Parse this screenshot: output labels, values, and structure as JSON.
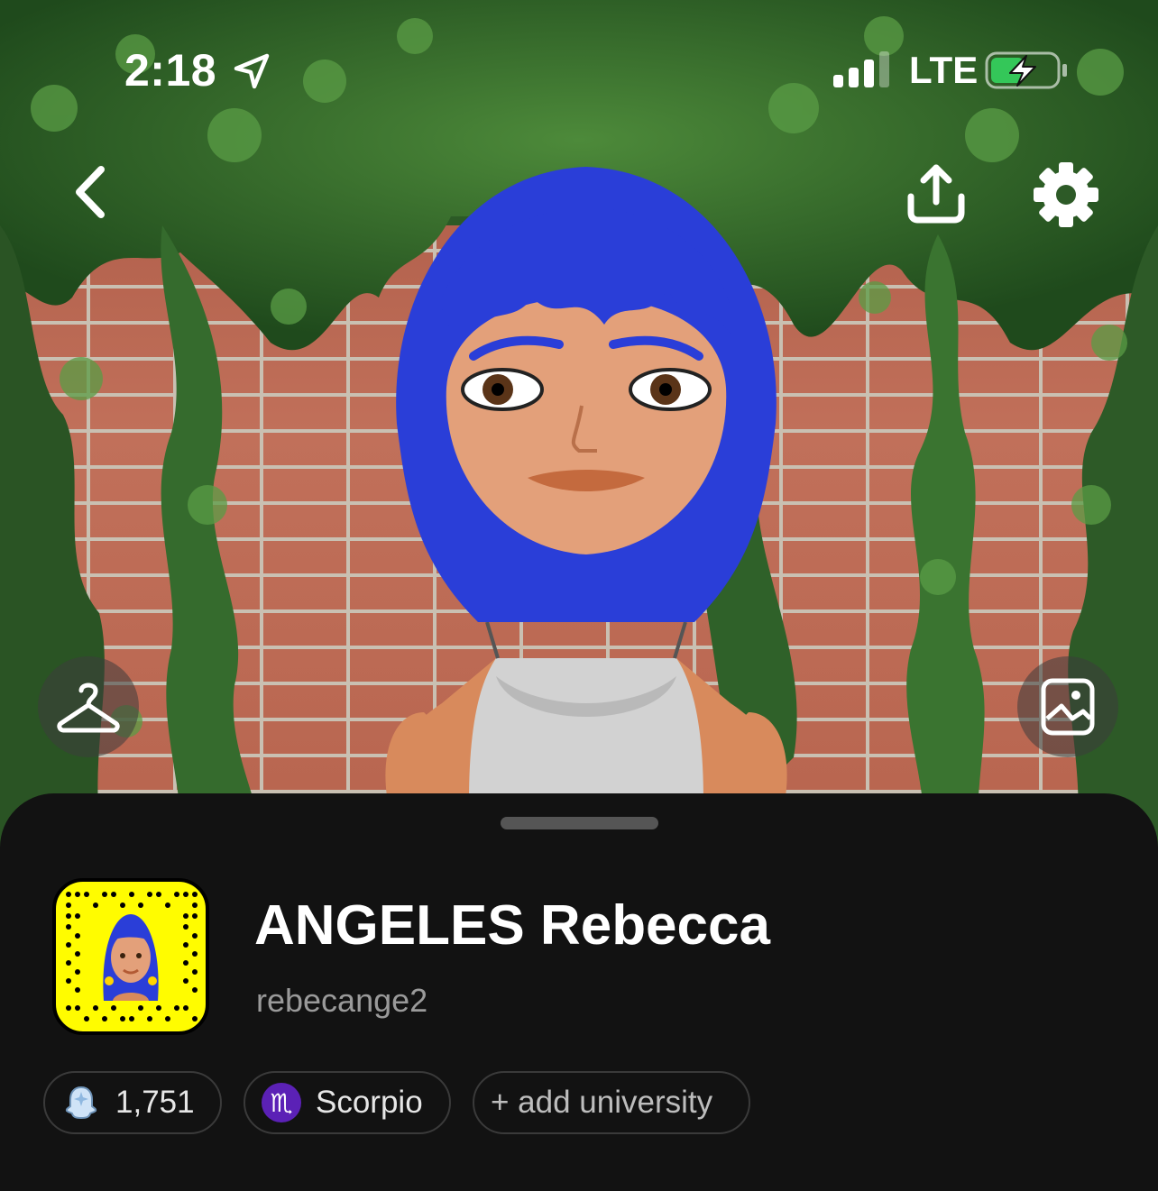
{
  "status_bar": {
    "time": "2:18",
    "network": "LTE",
    "icons": [
      "location-arrow-icon",
      "signal-bars-icon",
      "battery-charging-icon"
    ]
  },
  "top_actions": {
    "icons": [
      "chevron-left-icon",
      "share-upload-icon",
      "gear-icon"
    ]
  },
  "hero": {
    "left_button_icon": "hanger-icon",
    "right_button_icon": "image-frame-icon"
  },
  "profile": {
    "display_name": "ANGELES Rebecca",
    "username": "rebecange2",
    "snapcode_icon": "snapcode-icon"
  },
  "chips": {
    "score": "1,751",
    "zodiac_symbol": "♏",
    "zodiac": "Scorpio",
    "university": "+ add university"
  },
  "colors": {
    "snap_yellow": "#fffc00",
    "sheet_bg": "#121212",
    "zodiac_purple": "#5b21b6",
    "battery_green": "#34c759",
    "hair_blue": "#2a3ed8"
  }
}
